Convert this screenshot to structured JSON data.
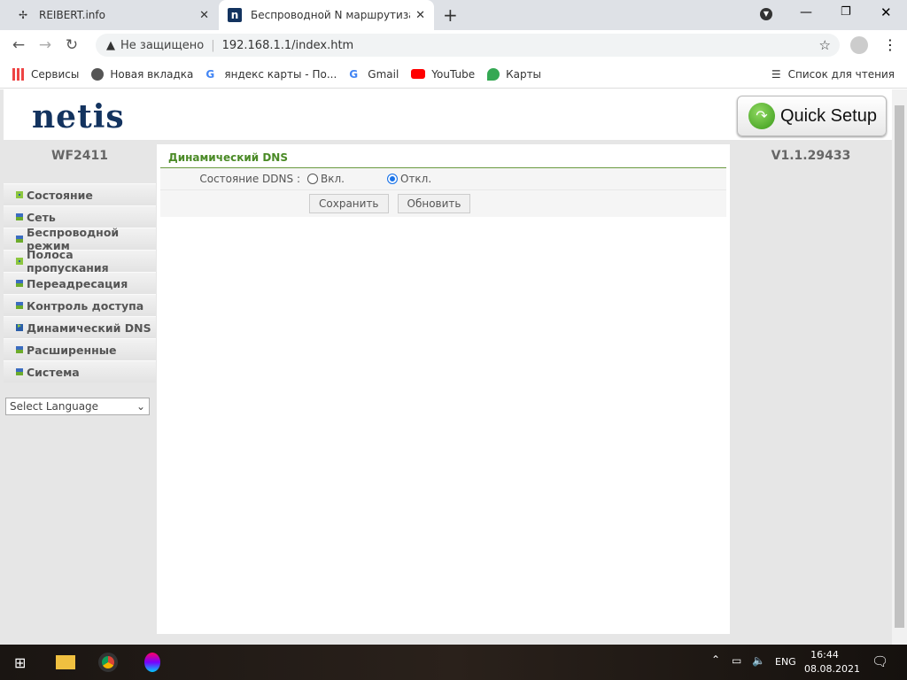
{
  "browser": {
    "tabs": [
      {
        "title": "REIBERT.info"
      },
      {
        "title": "Беспроводной N маршрутизатор"
      }
    ],
    "security": "Не защищено",
    "url": "192.168.1.1/index.htm",
    "bookmarks": [
      "Сервисы",
      "Новая вкладка",
      "яндекс карты - По...",
      "Gmail",
      "YouTube",
      "Карты"
    ],
    "reading_list": "Список для чтения"
  },
  "header": {
    "logo": "netis",
    "quick_setup": "Quick Setup"
  },
  "sidebar": {
    "model": "WF2411",
    "items": [
      "Состояние",
      "Сеть",
      "Беспроводной режим",
      "Полоса пропускания",
      "Переадресация",
      "Контроль доступа",
      "Динамический DNS",
      "Расширенные",
      "Система"
    ],
    "active_index": 6,
    "language": "Select Language"
  },
  "main": {
    "title": "Динамический DNS",
    "ddns_label": "Состояние DDNS :",
    "option_on": "Вкл.",
    "option_off": "Откл.",
    "selected": "Откл.",
    "save": "Сохранить",
    "refresh": "Обновить"
  },
  "version": "V1.1.29433",
  "taskbar": {
    "lang": "ENG",
    "time": "16:44",
    "date": "08.08.2021"
  }
}
